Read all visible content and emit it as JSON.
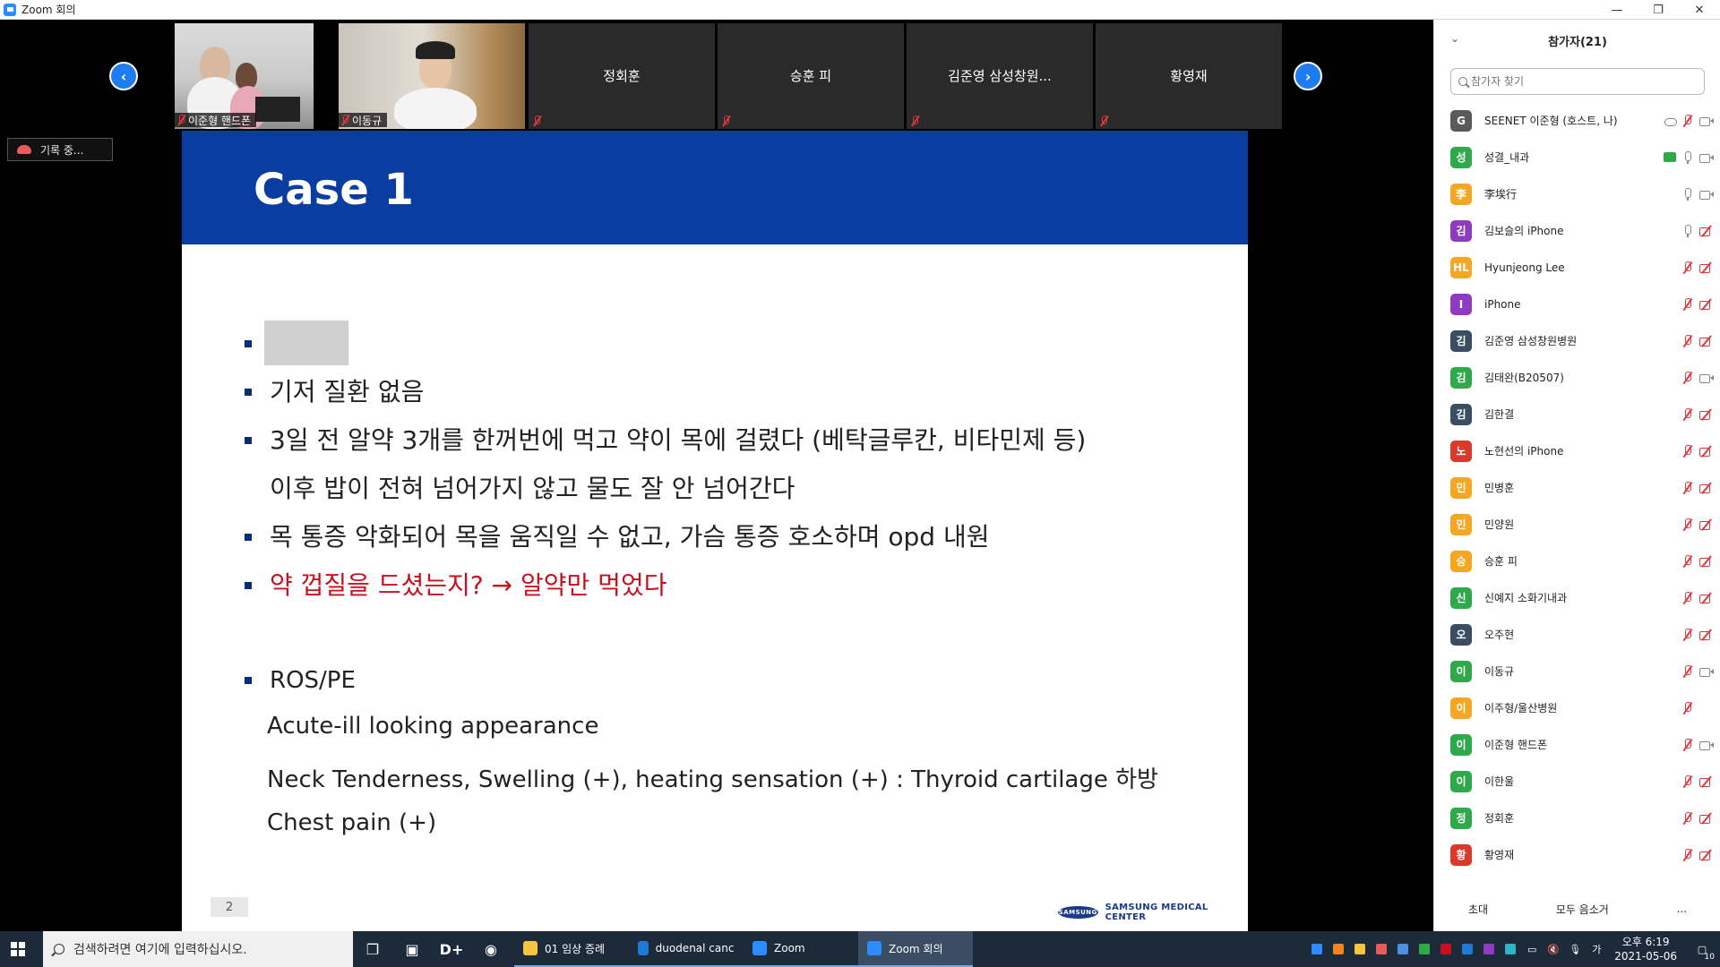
{
  "window": {
    "title": "Zoom 회의",
    "controls": [
      "—",
      "❐",
      "✕"
    ]
  },
  "thumbnails": {
    "prev_icon": "chevron-left-icon",
    "next_icon": "chevron-right-icon",
    "tiles": [
      {
        "name": "이준형 핸드폰",
        "video": true
      },
      {
        "name": "이동규",
        "video": true
      },
      {
        "name": "정회훈",
        "video": false
      },
      {
        "name": "승훈 피",
        "video": false
      },
      {
        "name": "김준영 삼성창원...",
        "video": false
      },
      {
        "name": "황영재",
        "video": false
      }
    ]
  },
  "recording": {
    "label": "기록 중..."
  },
  "slide": {
    "title": "Case 1",
    "bullets": [
      {
        "text": "",
        "redacted": true
      },
      {
        "text": "기저 질환 없음"
      },
      {
        "text": "3일 전 알약 3개를 한꺼번에 먹고 약이 목에 걸렸다 (베탁글루칸, 비타민제 등)",
        "cont": "이후 밥이 전혀 넘어가지 않고 물도 잘 안 넘어간다"
      },
      {
        "text": "목 통증 악화되어 목을 움직일 수 없고, 가슴 통증 호소하며 opd 내원"
      },
      {
        "text": "약 껍질을 드셨는지? → 알약만 먹었다",
        "color": "#c8101e"
      },
      {
        "text": "ROS/PE"
      }
    ],
    "findings": [
      "Acute-ill looking appearance",
      "Neck Tenderness, Swelling (+), heating sensation (+) : Thyroid cartilage 하방",
      "Chest pain (+)"
    ],
    "page_number": "2",
    "logo": {
      "badge": "SAMSUNG",
      "text": "SAMSUNG MEDICAL CENTER"
    }
  },
  "participants": {
    "title": "참가자(21)",
    "search_placeholder": "참가자 찾기",
    "list": [
      {
        "initial": "G",
        "name": "SEENET 이준형 (호스트, 나)",
        "color": "#5a5a5a",
        "mic": "off",
        "cam": "on",
        "extra": "cloud"
      },
      {
        "initial": "성",
        "name": "성결_내과",
        "color": "#2faa4a",
        "mic": "on",
        "cam": "on",
        "extra": "share"
      },
      {
        "initial": "李",
        "name": "李埃行",
        "color": "#f5a623",
        "mic": "on",
        "cam": "on"
      },
      {
        "initial": "김",
        "name": "김보슬의 iPhone",
        "color": "#8e3bbf",
        "mic": "on",
        "cam": "off"
      },
      {
        "initial": "HL",
        "name": "Hyunjeong Lee",
        "color": "#f5a623",
        "mic": "off",
        "cam": "off"
      },
      {
        "initial": "I",
        "name": "iPhone",
        "color": "#8e3bbf",
        "mic": "off",
        "cam": "off"
      },
      {
        "initial": "김",
        "name": "김준영 삼성창원병원",
        "color": "#3a4d63",
        "mic": "off",
        "cam": "off"
      },
      {
        "initial": "김",
        "name": "김태완(B20507)",
        "color": "#2faa4a",
        "mic": "off",
        "cam": "on"
      },
      {
        "initial": "김",
        "name": "김한결",
        "color": "#3a4d63",
        "mic": "off",
        "cam": "off"
      },
      {
        "initial": "노",
        "name": "노현선의 iPhone",
        "color": "#d93a2a",
        "mic": "off",
        "cam": "off"
      },
      {
        "initial": "민",
        "name": "민병훈",
        "color": "#f5a623",
        "mic": "off",
        "cam": "off"
      },
      {
        "initial": "민",
        "name": "민양원",
        "color": "#f5a623",
        "mic": "off",
        "cam": "off"
      },
      {
        "initial": "승",
        "name": "승훈 피",
        "color": "#f5a623",
        "mic": "off",
        "cam": "off"
      },
      {
        "initial": "신",
        "name": "신예지 소화기내과",
        "color": "#2faa4a",
        "mic": "off",
        "cam": "off"
      },
      {
        "initial": "오",
        "name": "오주현",
        "color": "#3a4d63",
        "mic": "off",
        "cam": "off"
      },
      {
        "initial": "이",
        "name": "이동규",
        "color": "#2faa4a",
        "mic": "off",
        "cam": "on"
      },
      {
        "initial": "이",
        "name": "이주형/울산병원",
        "color": "#f5a623",
        "mic": "off",
        "cam": "none"
      },
      {
        "initial": "이",
        "name": "이준형 핸드폰",
        "color": "#2faa4a",
        "mic": "off",
        "cam": "on"
      },
      {
        "initial": "이",
        "name": "이한울",
        "color": "#2faa4a",
        "mic": "off",
        "cam": "off"
      },
      {
        "initial": "정",
        "name": "정회훈",
        "color": "#2faa4a",
        "mic": "off",
        "cam": "off"
      },
      {
        "initial": "황",
        "name": "황영재",
        "color": "#d93a2a",
        "mic": "off",
        "cam": "off"
      }
    ],
    "footer": {
      "invite": "초대",
      "mute_all": "모두 음소거",
      "more": "..."
    }
  },
  "taskbar": {
    "search_placeholder": "검색하려면 여기에 입력하십시오.",
    "apps": [
      {
        "label": "01 임상 증례",
        "color": "#f5c542",
        "active": false
      },
      {
        "label": "duodenal cancer s...",
        "color": "#1e7ad6",
        "active": false
      },
      {
        "label": "Zoom",
        "color": "#2d8cff",
        "active": false
      },
      {
        "label": "Zoom 회의",
        "color": "#2d8cff",
        "active": true
      }
    ],
    "tray_lang": "가",
    "time": "오후 6:19",
    "date": "2021-05-06",
    "notifications": "10"
  }
}
